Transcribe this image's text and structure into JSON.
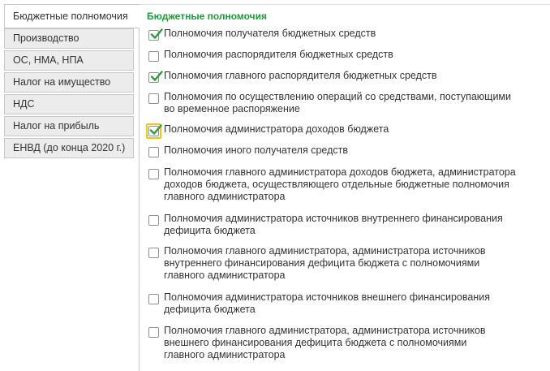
{
  "tabs": [
    {
      "label": "Бюджетные полномочия",
      "active": true
    },
    {
      "label": "Производство",
      "active": false
    },
    {
      "label": "ОС, НМА, НПА",
      "active": false
    },
    {
      "label": "Налог на имущество",
      "active": false
    },
    {
      "label": "НДС",
      "active": false
    },
    {
      "label": "Налог на прибыль",
      "active": false
    },
    {
      "label": "ЕНВД (до конца 2020 г.)",
      "active": false
    }
  ],
  "section": {
    "title": "Бюджетные полномочия",
    "accent_color": "#1d9a3a"
  },
  "options": [
    {
      "lines": [
        "Полномочия получателя бюджетных средств"
      ],
      "checked": true,
      "focused": false
    },
    {
      "lines": [
        "Полномочия распорядителя бюджетных средств"
      ],
      "checked": false,
      "focused": false
    },
    {
      "lines": [
        "Полномочия главного распорядителя бюджетных средств"
      ],
      "checked": true,
      "focused": false
    },
    {
      "lines": [
        "Полномочия по осуществлению операций со средствами, поступающими",
        "во временное распоряжение"
      ],
      "checked": false,
      "focused": false
    },
    {
      "lines": [
        "Полномочия администратора доходов бюджета"
      ],
      "checked": true,
      "focused": true
    },
    {
      "lines": [
        "Полномочия иного получателя средств"
      ],
      "checked": false,
      "focused": false
    },
    {
      "lines": [
        "Полномочия главного администратора доходов бюджета, администратора",
        "доходов бюджета, осуществляющего отдельные бюджетные полномочия",
        "главного администратора"
      ],
      "checked": false,
      "focused": false
    },
    {
      "lines": [
        "Полномочия администратора источников внутреннего финансирования",
        "дефицита бюджета"
      ],
      "checked": false,
      "focused": false
    },
    {
      "lines": [
        "Полномочия главного администратора, администратора источников",
        "внутреннего финансирования дефицита бюджета с полномочиями",
        "главного администратора"
      ],
      "checked": false,
      "focused": false
    },
    {
      "lines": [
        "Полномочия администратора источников внешнего финансирования",
        "дефицита бюджета"
      ],
      "checked": false,
      "focused": false
    },
    {
      "lines": [
        "Полномочия главного администратора, администратора источников",
        "внешнего финансирования дефицита бюджета с полномочиями",
        "главного администратора"
      ],
      "checked": false,
      "focused": false
    }
  ],
  "icons": {
    "check": "check-icon"
  },
  "colors": {
    "check": "#2e9b3e",
    "focus": "#f0c419"
  }
}
